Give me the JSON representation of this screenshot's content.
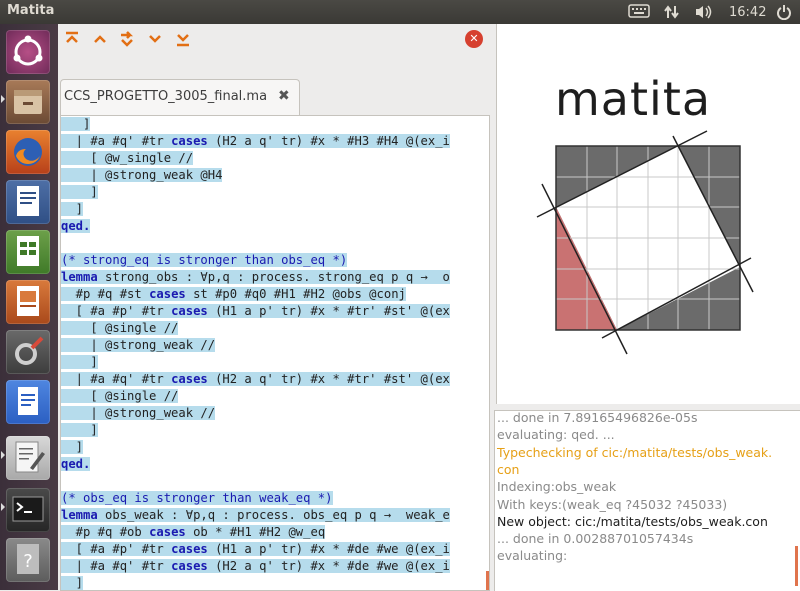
{
  "window": {
    "title": "Matita"
  },
  "tray": {
    "clock": "16:42"
  },
  "launcher": {
    "items": [
      "dash",
      "files",
      "firefox",
      "writer",
      "calc",
      "impress",
      "system-settings",
      "docs",
      "text-editor",
      "terminal",
      "help"
    ]
  },
  "toolbar": {
    "close_label": "✕"
  },
  "tab": {
    "label": "CCS_PROGETTO_3005_final.ma",
    "close": "✖"
  },
  "code": [
    "   ]",
    "  | #a #q' #tr cases (H2 a q' tr) #x * #H3 #H4 @(ex_i",
    "    [ @w_single //",
    "    | @strong_weak @H4",
    "    ]",
    "  ]",
    "qed.",
    "",
    "(* strong_eq is stronger than obs_eq *)",
    "lemma strong_obs : ∀p,q : process. strong_eq p q →  o",
    "  #p #q #st cases st #p0 #q0 #H1 #H2 @obs @conj",
    "  [ #a #p' #tr cases (H1 a p' tr) #x * #tr' #st' @(ex",
    "    [ @single //",
    "    | @strong_weak //",
    "    ]",
    "  | #a #q' #tr cases (H2 a q' tr) #x * #tr' #st' @(ex",
    "    [ @single //",
    "    | @strong_weak //",
    "    ]",
    "  ]",
    "qed.",
    "",
    "(* obs_eq is stronger than weak_eq *)",
    "lemma obs_weak : ∀p,q : process. obs_eq p q →  weak_e",
    "  #p #q #ob cases ob * #H1 #H2 @w_eq",
    "  [ #a #p' #tr cases (H1 a p' tr) #x * #de #we @(ex_i",
    "  | #a #q' #tr cases (H2 a q' tr) #x * #de #we @(ex_i",
    "  ]",
    "qed."
  ],
  "logo": {
    "text": "matita"
  },
  "messages": [
    {
      "text": "... done in 7.89165496826e-05s",
      "color": "grey"
    },
    {
      "text": "evaluating: qed. ...",
      "color": "grey"
    },
    {
      "text": "Typechecking of cic:/matita/tests/obs_weak.",
      "color": "orange"
    },
    {
      "text": "con",
      "color": "orange"
    },
    {
      "text": "Indexing:obs_weak",
      "color": "grey"
    },
    {
      "text": "With keys:(weak_eq ?45032 ?45033)",
      "color": "grey"
    },
    {
      "text": "New object: cic:/matita/tests/obs_weak.con",
      "color": "black"
    },
    {
      "text": "... done in 0.00288701057434s",
      "color": "grey"
    },
    {
      "text": "evaluating:",
      "color": "grey"
    }
  ],
  "colors": {
    "highlight": "#b6dcec",
    "accent": "#e26f14",
    "logo_red": "#c97272",
    "logo_grey": "#6b6b6b"
  }
}
